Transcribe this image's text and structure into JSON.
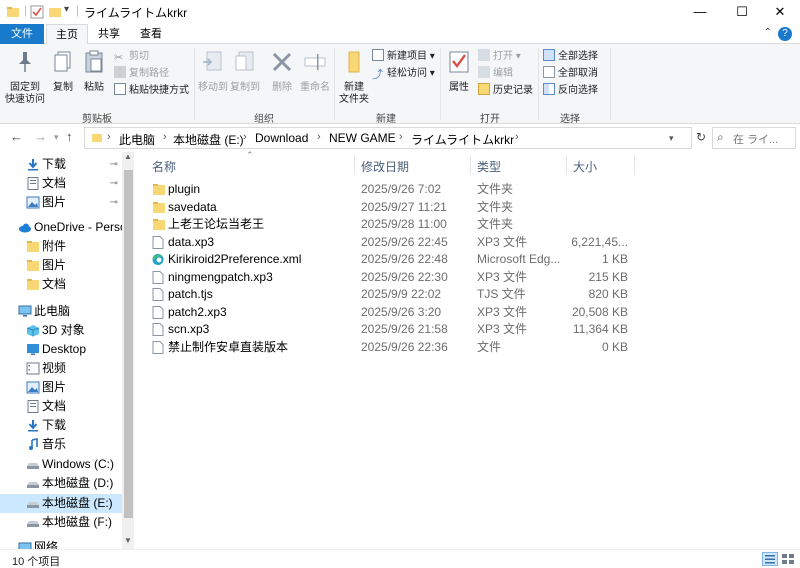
{
  "window": {
    "title": "ライムライトムkrkr",
    "minimize": "—",
    "maximize": "☐",
    "close": "✕"
  },
  "ribbon_tabs": [
    "文件",
    "主页",
    "共享",
    "查看"
  ],
  "ribbon": {
    "clipboard": {
      "pin_quick": "固定到\n快速访问",
      "copy": "复制",
      "paste": "粘贴",
      "cut": "剪切",
      "copy_path": "复制路径",
      "paste_shortcut": "粘贴快捷方式",
      "label": "剪贴板"
    },
    "organize": {
      "move_to": "移动到",
      "copy_to": "复制到",
      "delete": "删除",
      "rename": "重命名",
      "label": "组织"
    },
    "new": {
      "new_folder": "新建\n文件夹",
      "new_item": "新建项目",
      "easy_access": "轻松访问",
      "label": "新建"
    },
    "open": {
      "properties": "属性",
      "open": "打开",
      "edit": "编辑",
      "history": "历史记录",
      "label": "打开"
    },
    "select": {
      "select_all": "全部选择",
      "select_none": "全部取消",
      "invert": "反向选择",
      "label": "选择"
    }
  },
  "address": {
    "crumbs": [
      "此电脑",
      "本地磁盘 (E:)",
      "Download",
      "NEW GAME",
      "ライムライトムkrkr"
    ],
    "search_placeholder": "在 ライ..."
  },
  "sidebar": {
    "items": [
      {
        "label": "下载",
        "icon": "download-arrow-icon",
        "pinned": true
      },
      {
        "label": "文档",
        "icon": "document-icon",
        "pinned": true
      },
      {
        "label": "图片",
        "icon": "picture-icon",
        "pinned": true
      },
      {
        "label": "OneDrive - Personal",
        "icon": "cloud-icon",
        "pinned": false
      },
      {
        "label": "附件",
        "icon": "folder-icon",
        "pinned": false
      },
      {
        "label": "图片",
        "icon": "folder-icon",
        "pinned": false
      },
      {
        "label": "文档",
        "icon": "folder-icon",
        "pinned": false
      },
      {
        "label": "此电脑",
        "icon": "computer-icon",
        "pinned": false
      },
      {
        "label": "3D 对象",
        "icon": "cube-icon",
        "pinned": false
      },
      {
        "label": "Desktop",
        "icon": "desktop-icon",
        "pinned": false
      },
      {
        "label": "视频",
        "icon": "video-icon",
        "pinned": false
      },
      {
        "label": "图片",
        "icon": "picture-icon",
        "pinned": false
      },
      {
        "label": "文档",
        "icon": "document-icon",
        "pinned": false
      },
      {
        "label": "下载",
        "icon": "download-arrow-icon",
        "pinned": false
      },
      {
        "label": "音乐",
        "icon": "music-icon",
        "pinned": false
      },
      {
        "label": "Windows (C:)",
        "icon": "drive-icon",
        "pinned": false
      },
      {
        "label": "本地磁盘 (D:)",
        "icon": "drive-icon",
        "pinned": false
      },
      {
        "label": "本地磁盘 (E:)",
        "icon": "drive-icon",
        "pinned": false,
        "selected": true
      },
      {
        "label": "本地磁盘 (F:)",
        "icon": "drive-icon",
        "pinned": false
      },
      {
        "label": "网络",
        "icon": "network-icon",
        "pinned": false
      }
    ],
    "pin_glyph": "📌"
  },
  "columns": {
    "name": "名称",
    "date": "修改日期",
    "type": "类型",
    "size": "大小"
  },
  "files": [
    {
      "name": "plugin",
      "date": "2025/9/26 7:02",
      "type": "文件夹",
      "size": "",
      "icon": "folder-icon"
    },
    {
      "name": "savedata",
      "date": "2025/9/27 11:21",
      "type": "文件夹",
      "size": "",
      "icon": "folder-icon"
    },
    {
      "name": "上老王论坛当老王",
      "date": "2025/9/28 11:00",
      "type": "文件夹",
      "size": "",
      "icon": "folder-icon"
    },
    {
      "name": "data.xp3",
      "date": "2025/9/26 22:45",
      "type": "XP3 文件",
      "size": "6,221,45...",
      "icon": "file-icon"
    },
    {
      "name": "Kirikiroid2Preference.xml",
      "date": "2025/9/26 22:48",
      "type": "Microsoft Edg...",
      "size": "1 KB",
      "icon": "edge-icon"
    },
    {
      "name": "ningmengpatch.xp3",
      "date": "2025/9/26 22:30",
      "type": "XP3 文件",
      "size": "215 KB",
      "icon": "file-icon"
    },
    {
      "name": "patch.tjs",
      "date": "2025/9/9 22:02",
      "type": "TJS 文件",
      "size": "820 KB",
      "icon": "file-icon"
    },
    {
      "name": "patch2.xp3",
      "date": "2025/9/26 3:20",
      "type": "XP3 文件",
      "size": "20,508 KB",
      "icon": "file-icon"
    },
    {
      "name": "scn.xp3",
      "date": "2025/9/26 21:58",
      "type": "XP3 文件",
      "size": "11,364 KB",
      "icon": "file-icon"
    },
    {
      "name": "禁止制作安卓直装版本",
      "date": "2025/9/26 22:36",
      "type": "文件",
      "size": "0 KB",
      "icon": "file-icon"
    }
  ],
  "status": {
    "count": "10 个项目"
  },
  "colors": {
    "accent": "#1979ca",
    "folder": "#f8d775",
    "selected": "#cce8ff"
  }
}
